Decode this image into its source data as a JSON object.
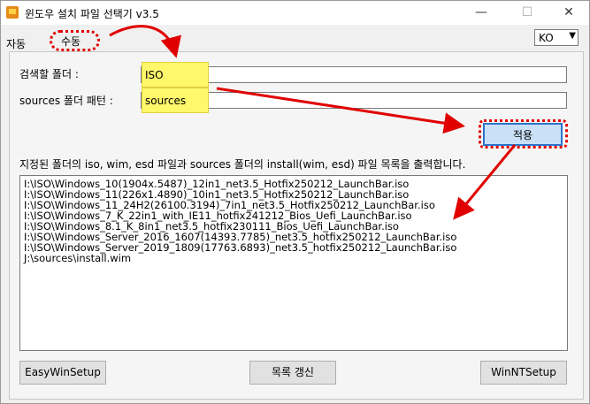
{
  "window": {
    "title": "윈도우 설치 파일 선택기 v3.5"
  },
  "tabs": [
    {
      "label": "자동"
    },
    {
      "label": "수동"
    }
  ],
  "language": {
    "value": "KO"
  },
  "search_folder": {
    "label": "검색할 폴더 :",
    "value": "ISO"
  },
  "sources_pattern": {
    "label": "sources 폴더 패턴 :",
    "value": "sources"
  },
  "apply_button": {
    "label": "적용"
  },
  "description": "지정된 폴더의 iso, wim, esd 파일과 sources 폴더의 install(wim, esd) 파일 목록을 출력합니다.",
  "file_list": [
    "I:\\ISO\\Windows_10(1904x.5487)_12in1_net3.5_Hotfix250212_LaunchBar.iso",
    "I:\\ISO\\Windows_11(226x1.4890)_10in1_net3.5_Hotfix250212_LaunchBar.iso",
    "I:\\ISO\\Windows_11_24H2(26100.3194)_7in1_net3.5_Hotfix250212_LaunchBar.iso",
    "I:\\ISO\\Windows_7_K_22in1_with_IE11_hotfix241212_Bios_Uefi_LaunchBar.iso",
    "I:\\ISO\\Windows_8.1_K_8in1_net3.5_hotfix230111_Bios_Uefi_LaunchBar.iso",
    "I:\\ISO\\Windows_Server_2016_1607(14393.7785)_net3.5_hotfix250212_LaunchBar.iso",
    "I:\\ISO\\Windows_Server_2019_1809(17763.6893)_net3.5_hotfix250212_LaunchBar.iso",
    "J:\\sources\\install.wim"
  ],
  "bottom_buttons": {
    "easywinsetup": "EasyWinSetup",
    "refresh": "목록 갱신",
    "winntsetup": "WinNTSetup"
  },
  "accent_colors": {
    "annotation_red": "#e00000",
    "highlight_yellow": "#fff86a",
    "focus_blue": "#2b73c9"
  }
}
